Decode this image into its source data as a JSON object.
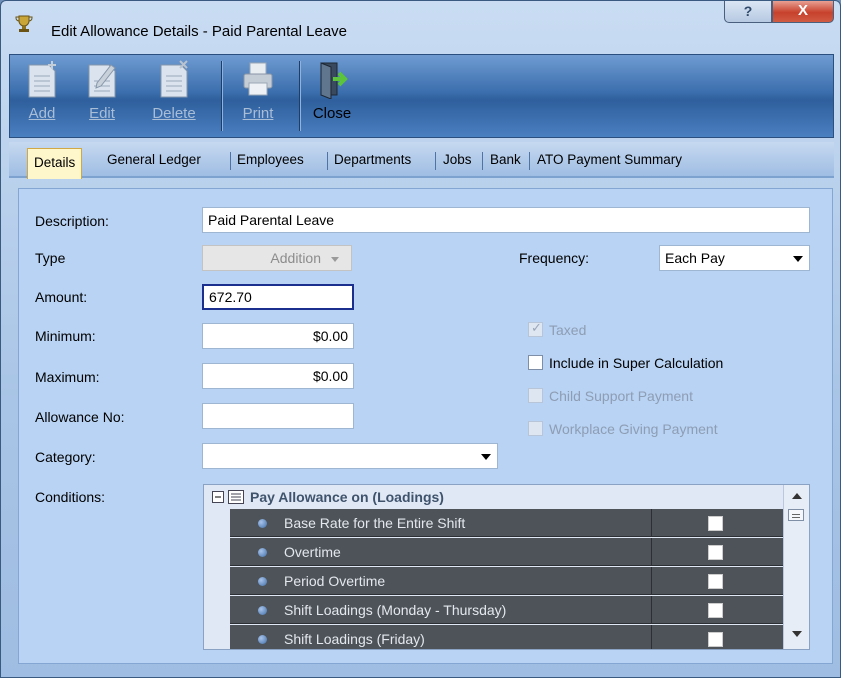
{
  "window": {
    "title": "Edit Allowance Details - Paid Parental Leave",
    "help_label": "?",
    "close_label": "X"
  },
  "toolbar": {
    "add_label": "Add",
    "edit_label": "Edit",
    "delete_label": "Delete",
    "print_label": "Print",
    "close_label": "Close"
  },
  "tabs": [
    {
      "label": "Details"
    },
    {
      "label": "General Ledger"
    },
    {
      "label": "Employees"
    },
    {
      "label": "Departments"
    },
    {
      "label": "Jobs"
    },
    {
      "label": "Bank"
    },
    {
      "label": "ATO Payment Summary"
    }
  ],
  "form": {
    "description_label": "Description:",
    "description_value": "Paid Parental Leave",
    "type_label": "Type",
    "type_value": "Addition",
    "amount_label": "Amount:",
    "amount_value": "672.70",
    "minimum_label": "Minimum:",
    "minimum_value": "$0.00",
    "maximum_label": "Maximum:",
    "maximum_value": "$0.00",
    "allowance_no_label": "Allowance No:",
    "allowance_no_value": "",
    "category_label": "Category:",
    "category_value": "",
    "conditions_label": "Conditions:",
    "frequency_label": "Frequency:",
    "frequency_value": "Each Pay"
  },
  "checkboxes": {
    "taxed": {
      "label": "Taxed",
      "checked": true,
      "disabled": true
    },
    "include_super": {
      "label": "Include in Super Calculation",
      "checked": false,
      "disabled": false
    },
    "child_support": {
      "label": "Child Support Payment",
      "checked": false,
      "disabled": true
    },
    "workplace_giving": {
      "label": "Workplace Giving Payment",
      "checked": false,
      "disabled": true
    }
  },
  "conditions": {
    "header": "Pay Allowance on (Loadings)",
    "rows": [
      {
        "label": "Base Rate for the Entire Shift",
        "checked": false
      },
      {
        "label": "Overtime",
        "checked": false
      },
      {
        "label": "Period Overtime",
        "checked": false
      },
      {
        "label": "Shift Loadings (Monday - Thursday)",
        "checked": false
      },
      {
        "label": "Shift Loadings (Friday)",
        "checked": false
      }
    ]
  },
  "colors": {
    "accent_tab": "#fff7cc",
    "toolbar": "#3c6fae",
    "panel": "#b8d3f4",
    "grid_row": "#4d5359"
  }
}
